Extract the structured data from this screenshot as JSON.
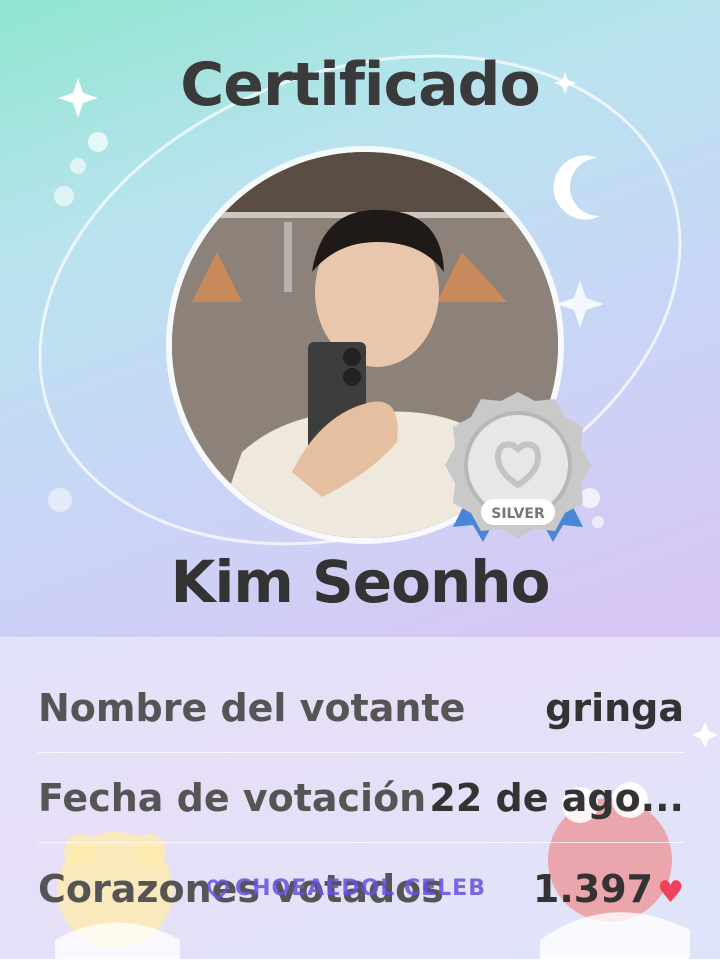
{
  "certificate": {
    "title": "Certificado",
    "celebrity_name": "Kim Seonho",
    "badge": {
      "tier_label": "SILVER",
      "icon": "silver-medal-badge-icon"
    },
    "photo": {
      "icon": "celebrity-photo"
    }
  },
  "details": [
    {
      "label": "Nombre del votante",
      "value": "gringa"
    },
    {
      "label": "Fecha de votación",
      "value": "22 de ago..."
    },
    {
      "label": "Corazones votados",
      "value": "1.397",
      "icon": "heart-icon"
    }
  ],
  "watermark": {
    "text": "CHOEAEDOL CELEB",
    "icon": "choeaedol-logo-icon"
  },
  "colors": {
    "heart": "#f0415a",
    "text_dark": "#333333",
    "watermark": "#6c4fe0"
  }
}
